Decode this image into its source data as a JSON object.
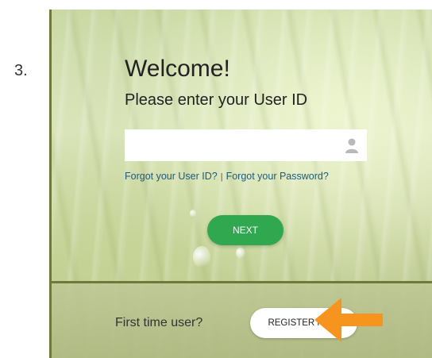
{
  "step_number": "3.",
  "login": {
    "welcome": "Welcome!",
    "subtitle": "Please enter your User ID",
    "userid_value": "",
    "forgot_userid": "Forgot your User ID?",
    "separator": "|",
    "forgot_password": "Forgot your Password?",
    "next_label": "NEXT"
  },
  "footer": {
    "first_time_label": "First time user?",
    "register_label": "REGISTER NOW"
  },
  "colors": {
    "next_button": "#2fa84f",
    "links": "#1c5b80",
    "arrow": "#f7941d"
  },
  "icons": [
    "user-icon",
    "arrow-left-icon"
  ]
}
